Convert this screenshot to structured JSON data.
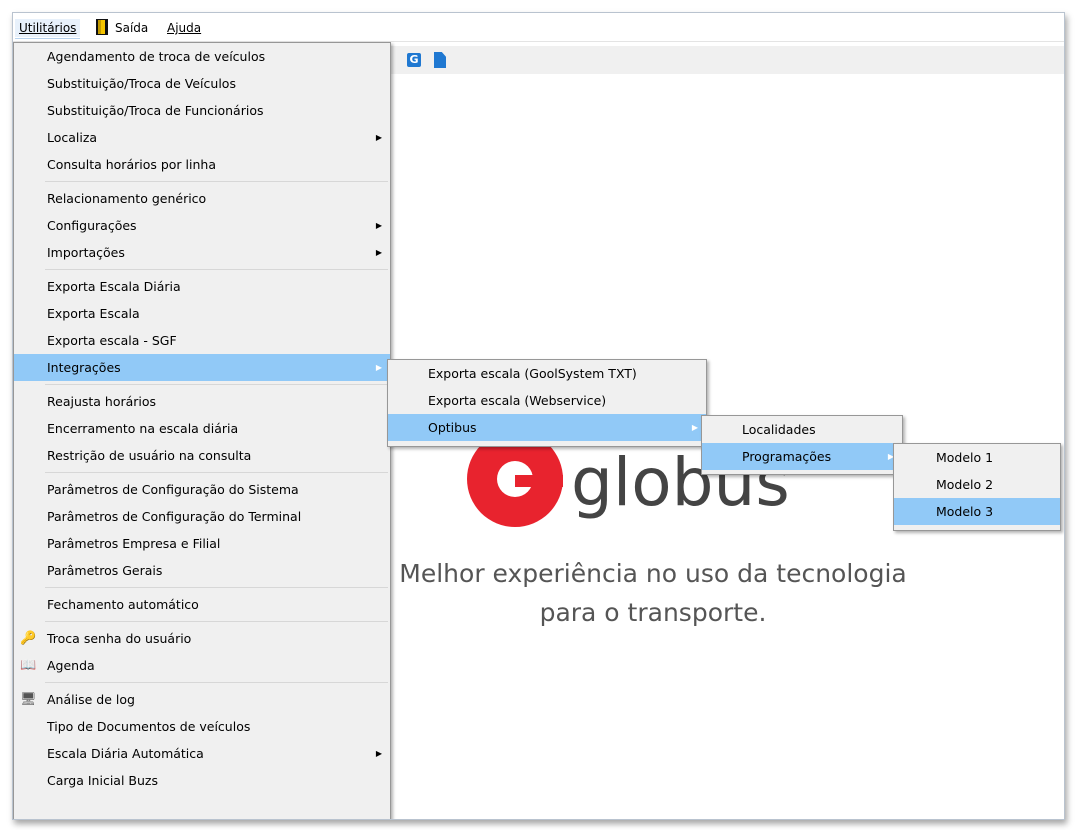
{
  "menubar": {
    "utilitarios": "Utilitários",
    "saida": "Saída",
    "ajuda": "Ajuda"
  },
  "toolbar": {
    "g_icon": "G"
  },
  "brand": {
    "logo_text": "globus",
    "slogan_line1": "Melhor experiência no uso da tecnologia",
    "slogan_line2": "para o transporte."
  },
  "utilitarios_menu": {
    "items": [
      "Agendamento de troca de veículos",
      "Substituição/Troca de Veículos",
      "Substituição/Troca de Funcionários",
      "Localiza",
      "Consulta horários por linha",
      "Relacionamento genérico",
      "Configurações",
      "Importações",
      "Exporta Escala Diária",
      "Exporta Escala",
      "Exporta escala - SGF",
      "Integrações",
      "Reajusta horários",
      "Encerramento na escala diária",
      "Restrição de usuário na consulta",
      "Parâmetros de Configuração do Sistema",
      "Parâmetros de Configuração do Terminal",
      "Parâmetros Empresa e Filial",
      "Parâmetros Gerais",
      "Fechamento automático",
      "Troca senha do usuário",
      "Agenda",
      "Análise de log",
      "Tipo de Documentos de veículos",
      "Escala Diária Automática",
      "Carga Inicial Buzs"
    ]
  },
  "integracoes_menu": {
    "items": [
      "Exporta escala (GoolSystem TXT)",
      "Exporta escala (Webservice)",
      "Optibus"
    ]
  },
  "optibus_menu": {
    "items": [
      "Localidades",
      "Programações"
    ]
  },
  "programacoes_menu": {
    "items": [
      "Modelo 1",
      "Modelo 2",
      "Modelo 3"
    ]
  },
  "icons": {
    "submenu_arrow": "▶",
    "key": "🔑",
    "book": "📖",
    "log": "🖥"
  },
  "colors": {
    "highlight": "#91c9f7",
    "menu_bg": "#f0f0f0",
    "brand_red": "#e8232e"
  }
}
